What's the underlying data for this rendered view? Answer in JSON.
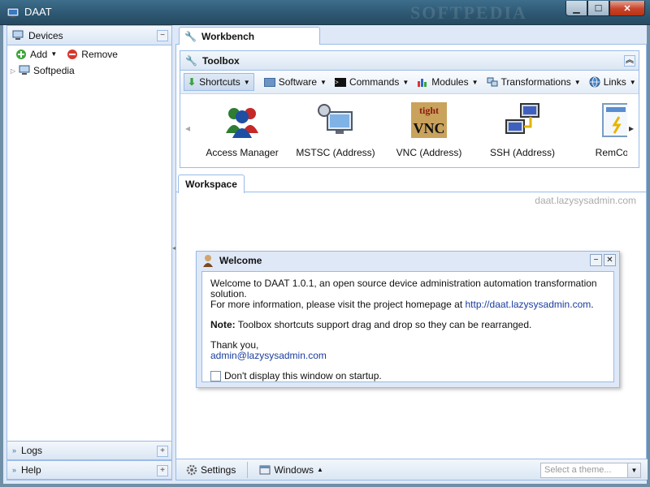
{
  "window": {
    "title": "DAAT",
    "watermark": "SOFTPEDIA"
  },
  "devices": {
    "title": "Devices",
    "add_label": "Add",
    "remove_label": "Remove",
    "tree": [
      {
        "label": "Softpedia"
      }
    ]
  },
  "bottom_panels": [
    {
      "label": "Logs"
    },
    {
      "label": "Help"
    }
  ],
  "workbench": {
    "tab_label": "Workbench"
  },
  "toolbox": {
    "title": "Toolbox",
    "menu": [
      {
        "label": "Shortcuts",
        "icon": "download-arrow-icon"
      },
      {
        "label": "Software",
        "icon": "folder-icon"
      },
      {
        "label": "Commands",
        "icon": "terminal-icon"
      },
      {
        "label": "Modules",
        "icon": "bar-chart-icon"
      },
      {
        "label": "Transformations",
        "icon": "transform-icon"
      },
      {
        "label": "Links",
        "icon": "globe-icon"
      }
    ],
    "shortcuts": [
      {
        "label": "Access Manager",
        "icon": "users-icon"
      },
      {
        "label": "MSTSC (Address)",
        "icon": "remote-desktop-icon"
      },
      {
        "label": "VNC (Address)",
        "icon": "vnc-icon"
      },
      {
        "label": "SSH (Address)",
        "icon": "network-computers-icon"
      },
      {
        "label": "RemCom",
        "icon": "doc-icon"
      }
    ]
  },
  "workspace": {
    "tab_label": "Workspace",
    "site_text": "daat.lazysysadmin.com"
  },
  "welcome": {
    "title": "Welcome",
    "line1": "Welcome to DAAT 1.0.1, an open source device administration automation transformation solution.",
    "line2": "For more information, please visit the project homepage at",
    "homepage": "http://daat.lazysysadmin.com",
    "period": ".",
    "note_label": "Note:",
    "note_text": "Toolbox shortcuts support drag and drop so they can be rearranged.",
    "thanks": "Thank you,",
    "email": "admin@lazysysadmin.com",
    "checkbox_label": "Don't display this window on startup."
  },
  "statusbar": {
    "settings_label": "Settings",
    "windows_label": "Windows",
    "theme_placeholder": "Select a theme..."
  },
  "colors": {
    "accent_border": "#99bbe8",
    "panel_bg": "#dfe8f6",
    "link": "#1a3d9e"
  }
}
